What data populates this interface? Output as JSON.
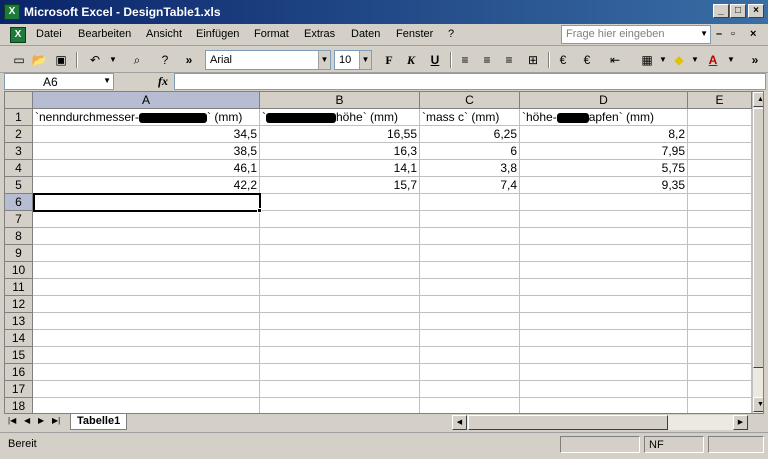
{
  "window": {
    "title": "Microsoft Excel - DesignTable1.xls"
  },
  "menu": {
    "items": [
      "Datei",
      "Bearbeiten",
      "Ansicht",
      "Einfügen",
      "Format",
      "Extras",
      "Daten",
      "Fenster",
      "?"
    ],
    "help_placeholder": "Frage hier eingeben"
  },
  "toolbar": {
    "font": "Arial",
    "size": "10"
  },
  "formula": {
    "cell_ref": "A6",
    "content": ""
  },
  "columns": [
    "A",
    "B",
    "C",
    "D",
    "E"
  ],
  "rows": [
    "1",
    "2",
    "3",
    "4",
    "5",
    "6",
    "7",
    "8",
    "9",
    "10",
    "11",
    "12",
    "13",
    "14",
    "15",
    "16",
    "17",
    "18"
  ],
  "headers": {
    "a_pre": "`nenndurchmesser-",
    "a_post": "` (mm)",
    "b_pre": "`",
    "b_post": "höhe` (mm)",
    "c": "`mass c` (mm)",
    "d_pre": "`höhe-",
    "d_post": "apfen` (mm)"
  },
  "data": [
    [
      "34,5",
      "16,55",
      "6,25",
      "8,2"
    ],
    [
      "38,5",
      "16,3",
      "6",
      "7,95"
    ],
    [
      "46,1",
      "14,1",
      "3,8",
      "5,75"
    ],
    [
      "42,2",
      "15,7",
      "7,4",
      "9,35"
    ]
  ],
  "sheet_tab": "Tabelle1",
  "status": {
    "text": "Bereit",
    "mode": "NF"
  }
}
